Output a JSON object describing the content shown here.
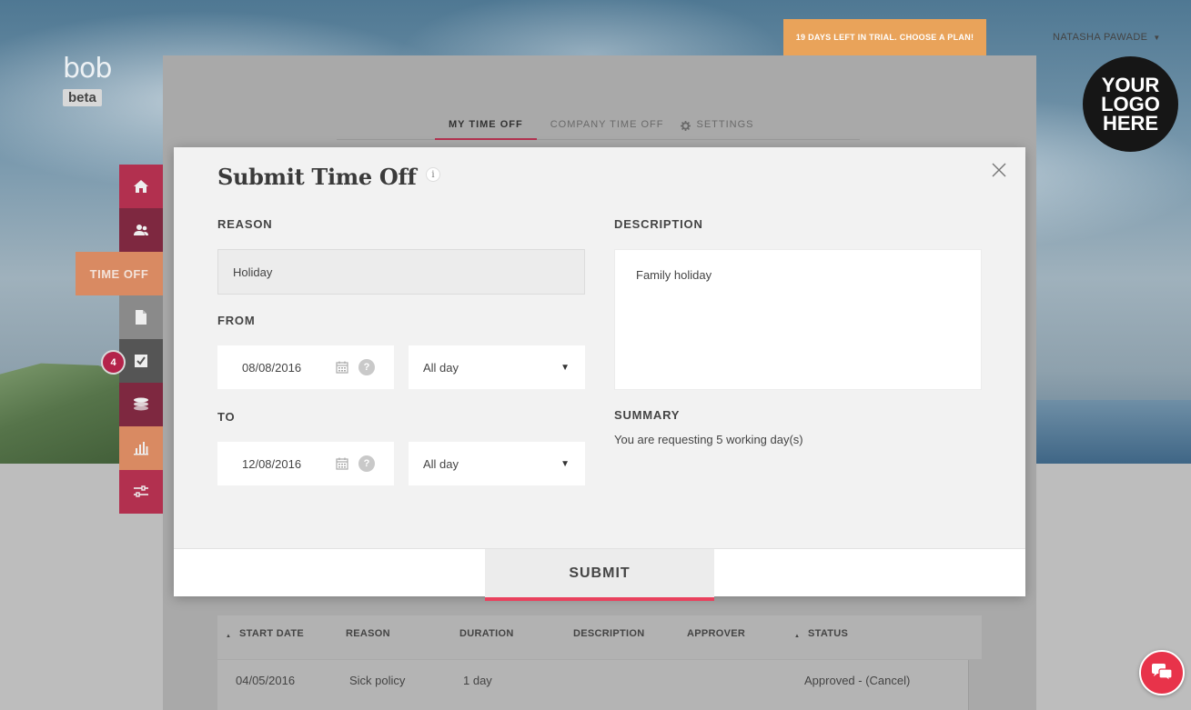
{
  "brand": {
    "name": "bob",
    "badge": "beta"
  },
  "trial_banner": "19 DAYS LEFT IN TRIAL. CHOOSE A PLAN!",
  "user": {
    "name": "NATASHA PAWADE",
    "menu_arrow": "▼"
  },
  "company_logo": {
    "line1": "YOUR",
    "line2": "LOGO",
    "line3": "HERE"
  },
  "tabs": [
    {
      "label": "MY TIME OFF",
      "active": true
    },
    {
      "label": "COMPANY TIME OFF",
      "active": false
    },
    {
      "label": "SETTINGS",
      "active": false,
      "icon": "gear-icon"
    }
  ],
  "sidebar": {
    "active_label": "TIME OFF",
    "badge_count": "4",
    "items": [
      {
        "icon": "home-icon",
        "color": "#b2304f"
      },
      {
        "icon": "people-icon",
        "color": "#7e2840"
      },
      {
        "icon": "time-off-icon",
        "color": "#d98a62"
      },
      {
        "icon": "document-icon",
        "color": "#8a8a8a"
      },
      {
        "icon": "checkbox-icon",
        "color": "#555555"
      },
      {
        "icon": "coins-icon",
        "color": "#7e2840"
      },
      {
        "icon": "bar-chart-icon",
        "color": "#d98a62"
      },
      {
        "icon": "sliders-icon",
        "color": "#b2304f"
      }
    ]
  },
  "modal": {
    "title": "Submit Time Off",
    "info": "i",
    "reason": {
      "label": "REASON",
      "value": "Holiday"
    },
    "from": {
      "label": "FROM",
      "date": "08/08/2016",
      "period": "All day"
    },
    "to": {
      "label": "TO",
      "date": "12/08/2016",
      "period": "All day"
    },
    "help": "?",
    "description": {
      "label": "DESCRIPTION",
      "value": "Family holiday"
    },
    "summary": {
      "label": "SUMMARY",
      "text": "You are requesting 5 working day(s)"
    },
    "submit_label": "SUBMIT",
    "select_arrow": "▼"
  },
  "table": {
    "columns": [
      "START DATE",
      "REASON",
      "DURATION",
      "DESCRIPTION",
      "APPROVER",
      "STATUS"
    ],
    "sort_arrow": "▲",
    "rows": [
      {
        "start_date": "04/05/2016",
        "reason": "Sick policy",
        "duration": "1 day",
        "description": "",
        "approver": "",
        "status": "Approved - (Cancel)"
      }
    ]
  },
  "colors": {
    "accent": "#e9415d",
    "brand_red": "#b2304f",
    "trial_orange": "#e9a35a"
  }
}
